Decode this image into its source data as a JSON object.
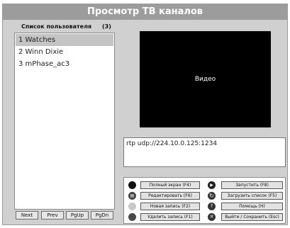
{
  "window": {
    "title": "Просмотр ТВ каналов"
  },
  "user_list": {
    "header": "Список пользователя",
    "count": "(3)",
    "items": [
      {
        "label": "1  Watches",
        "selected": true
      },
      {
        "label": "2  Winn Dixie",
        "selected": false
      },
      {
        "label": "3  mPhase_ac3",
        "selected": false
      }
    ]
  },
  "nav": {
    "next": "Next",
    "prev": "Prev",
    "pgup": "PgUp",
    "pgdn": "PgDn"
  },
  "video": {
    "label": "Видео"
  },
  "url_field": {
    "value": "rtp udp://224.10.0.125:1234"
  },
  "controls": {
    "fullscreen": "Полный экран (F4)",
    "edit": "Редактировать (F6)",
    "new_entry": "Новая запись (F2)",
    "delete_entry": "Удалить запись (F1)",
    "start": "Запустить (F8)",
    "load_list": "Загрузить список (F5)",
    "help": "Помощь (H)",
    "exit_save": "Выйти / Сохранить (Esc)"
  },
  "icons": {
    "fullscreen": "black-circle-icon",
    "edit": "edit-icon",
    "new_entry": "light-circle-icon",
    "delete_entry": "dark-circle-icon",
    "start": "play-icon",
    "load_list": "reload-icon",
    "help": "help-icon",
    "exit_save": "close-icon"
  }
}
